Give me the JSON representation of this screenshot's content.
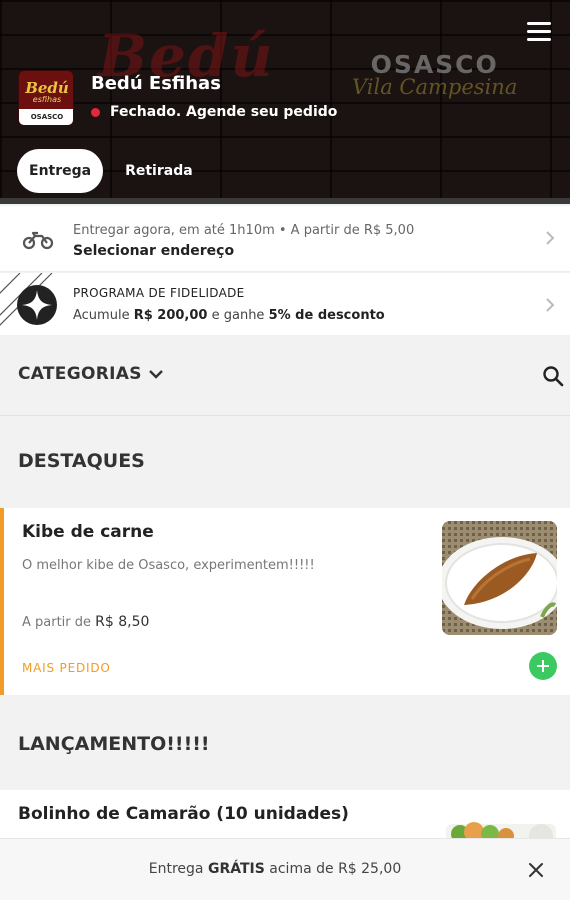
{
  "header": {
    "bg_brand": "Bedú",
    "bg_city": "OSASCO",
    "bg_district": "Vila Campesina",
    "logo": {
      "line1": "Bedú",
      "line2": "esfihas",
      "line3": "OSASCO"
    },
    "store_name": "Bedú Esfihas",
    "status": "Fechado. Agende seu pedido",
    "status_color": "#e8263a",
    "menu_icon": "hamburger-menu-icon"
  },
  "tabs": [
    {
      "label": "Entrega",
      "active": true
    },
    {
      "label": "Retirada",
      "active": false
    }
  ],
  "delivery": {
    "icon": "motorcycle-icon",
    "line1": "Entregar agora, em até 1h10m • A partir de R$ 5,00",
    "line2": "Selecionar endereço"
  },
  "loyalty": {
    "icon": "star-badge-icon",
    "title": "PROGRAMA DE FIDELIDADE",
    "desc_prefix": "Acumule",
    "amount": "R$ 200,00",
    "desc_middle": "e ganhe",
    "discount": "5% de desconto"
  },
  "categories": {
    "label": "CATEGORIAS",
    "icon": "chevron-down-icon",
    "search_icon": "search-icon"
  },
  "sections": [
    {
      "title": "DESTAQUES",
      "products": [
        {
          "name": "Kibe de carne",
          "description": "O melhor kibe de Osasco, experimentem!!!!!",
          "price_prefix": "A partir de",
          "price": "R$ 8,50",
          "badge": "MAIS PEDIDO"
        }
      ]
    },
    {
      "title": "LANÇAMENTO!!!!!",
      "products": [
        {
          "name": "Bolinho de Camarão (10 unidades)"
        }
      ]
    }
  ],
  "banner": {
    "prefix": "Entrega",
    "highlight": "GRÁTIS",
    "suffix": "acima de R$ 25,00",
    "close_icon": "close-icon"
  },
  "colors": {
    "accent": "#f09c26",
    "add": "#3bc962",
    "header_bg": "#1b1212"
  }
}
